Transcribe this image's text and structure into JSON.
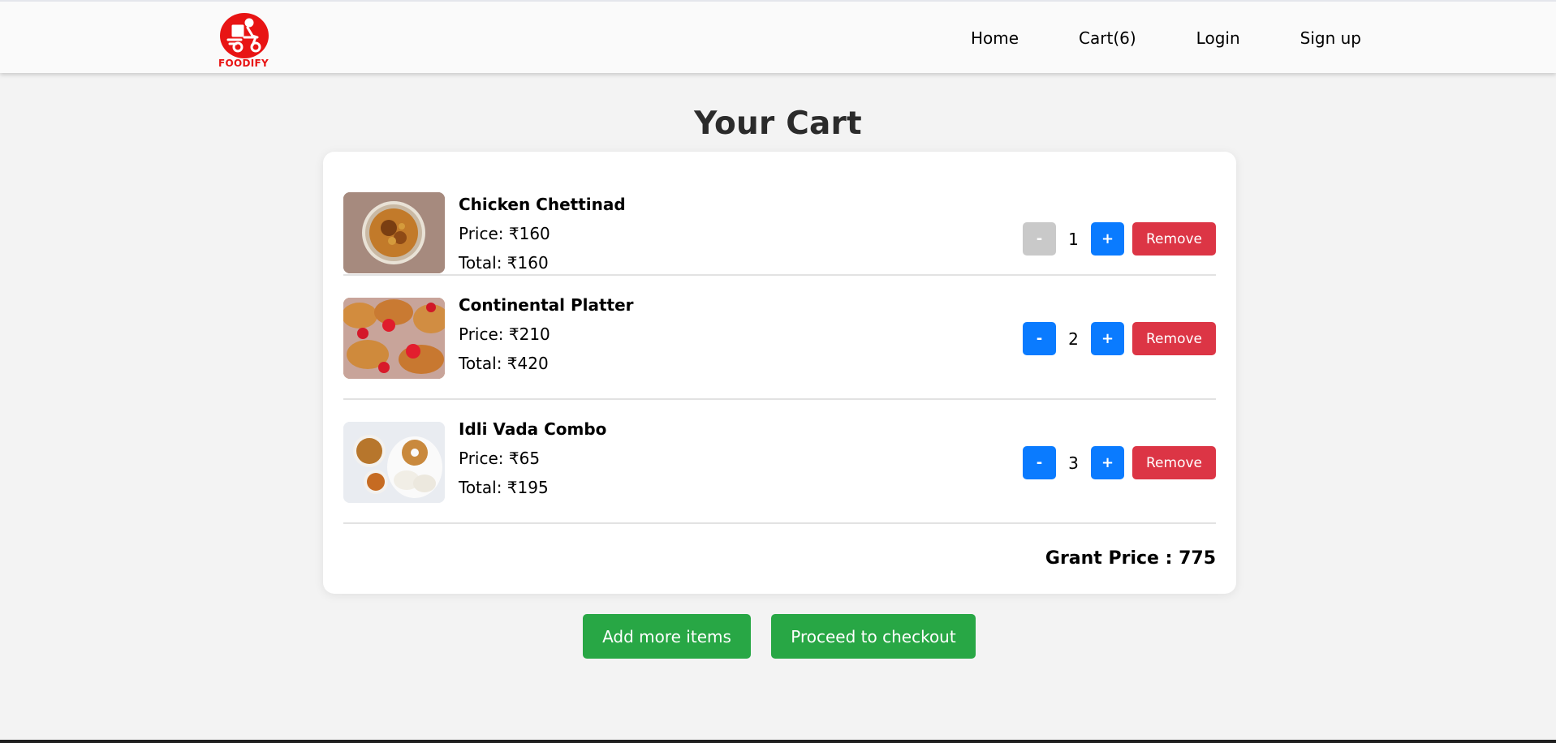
{
  "brand": {
    "name": "FOODIFY",
    "accent": "#e81414"
  },
  "nav": {
    "home": "Home",
    "cart": "Cart(6)",
    "login": "Login",
    "signup": "Sign up"
  },
  "page": {
    "title": "Your Cart"
  },
  "items": [
    {
      "name": "Chicken Chettinad",
      "price": "Price: ₹160",
      "total": "Total: ₹160",
      "qty": "1",
      "minus": "-",
      "plus": "+",
      "remove": "Remove",
      "image": "chicken-chettinad-dish"
    },
    {
      "name": "Continental Platter",
      "price": "Price: ₹210",
      "total": "Total: ₹420",
      "qty": "2",
      "minus": "-",
      "plus": "+",
      "remove": "Remove",
      "image": "croissant-strawberry-platter"
    },
    {
      "name": "Idli Vada Combo",
      "price": "Price: ₹65",
      "total": "Total: ₹195",
      "qty": "3",
      "minus": "-",
      "plus": "+",
      "remove": "Remove",
      "image": "idli-vada-plate"
    }
  ],
  "summary": {
    "grand_price": "Grant Price : 775"
  },
  "actions": {
    "add_more": "Add more items",
    "checkout": "Proceed to checkout"
  },
  "colors": {
    "primary": "#0a7bff",
    "danger": "#dc3545",
    "success": "#28a745",
    "disabled": "#c9c9c9"
  }
}
